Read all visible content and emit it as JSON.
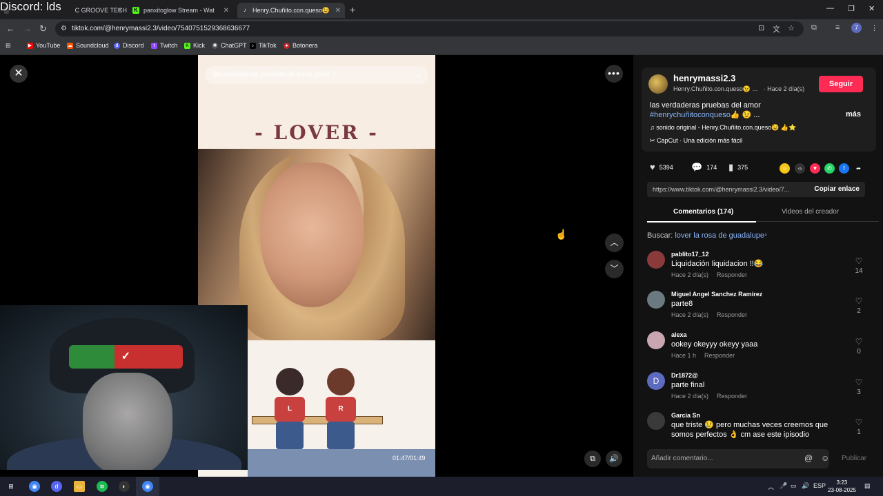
{
  "overlay_title": "Discord: lds",
  "tabs": [
    {
      "label": "tab 1 — ...C GROOVE TECH",
      "short": "C GROOVE TECH"
    },
    {
      "label": "panxitoglow Stream - Wat"
    },
    {
      "label": "Henry.Chuñito.con.queso😉"
    }
  ],
  "address": "tiktok.com/@henrymassi2.3/video/7540751529368636677",
  "bookmarks": [
    "YouTube",
    "Soundcloud",
    "Discord",
    "Twitch",
    "Kick",
    "ChatGPT",
    "TikTok",
    "Botonera"
  ],
  "video": {
    "search_text": "las verdaderas pruebas de amor parte 2",
    "overlay_title": "- LOVER -",
    "kid_left_letter": "L",
    "kid_right_letter": "R",
    "timecode": "01:47/01:49"
  },
  "webcam": {
    "logo": "✓"
  },
  "creator": {
    "username": "henrymassi2.3",
    "nickname": "Henry.Chuñito.con.queso😉 ...",
    "posted": "· Hace 2 día(s)",
    "follow_label": "Seguir",
    "description_line1": "las verdaderas pruebas del amor",
    "description_hashtag": "#henrychuñitoconqueso",
    "description_tail": "👍 😉 ...",
    "more_label": "más",
    "sound": "sonido original - Henry.Chuñito.con.queso😉 👍⭐",
    "capcut": "CapCut · Una edición más fácil"
  },
  "stats": {
    "likes": "5394",
    "comments": "174",
    "saves": "375"
  },
  "link": {
    "url": "https://www.tiktok.com/@henrymassi2.3/video/7...",
    "copy_label": "Copiar enlace"
  },
  "comment_tabs": {
    "comments": "Comentarios (174)",
    "creator_videos": "Videos del creador"
  },
  "search": {
    "prefix": "Buscar:",
    "query": "lover la rosa de guadalupe"
  },
  "comments": [
    {
      "user": "pablito17_12",
      "text": "Liquidación liquidacion !!😂",
      "time": "Hace 2 día(s)",
      "reply": "Responder",
      "likes": "14",
      "avatar_color": "#8a3a3a"
    },
    {
      "user": "Miguel Angel Sanchez Ramirez",
      "text": "parte8",
      "time": "Hace 2 día(s)",
      "reply": "Responder",
      "likes": "2",
      "avatar_color": "#6a7a80"
    },
    {
      "user": "alexa",
      "text": "ookey okeyyy okeyy yaaa",
      "time": "Hace 1 h",
      "reply": "Responder",
      "likes": "0",
      "avatar_color": "#c9a5b0"
    },
    {
      "user": "Dr1872@",
      "text": "parte final",
      "time": "Hace 2 día(s)",
      "reply": "Responder",
      "likes": "3",
      "avatar_color": "#5c6bc0",
      "initial": "D"
    },
    {
      "user": "Garcia Sn",
      "text": "que triste 😢 pero muchas veces creemos que somos perfectos 👌 cm ase este ipisodio",
      "time": "",
      "reply": "",
      "likes": "1",
      "avatar_color": "#3a3a3a"
    }
  ],
  "composer": {
    "placeholder": "Añadir comentario...",
    "publish": "Publicar"
  },
  "taskbar": {
    "lang": "ESP",
    "time": "3:23",
    "date": "23-08-2025"
  },
  "colors": {
    "accent_follow": "#fe2c55",
    "hashtag": "#8ab4f8"
  }
}
